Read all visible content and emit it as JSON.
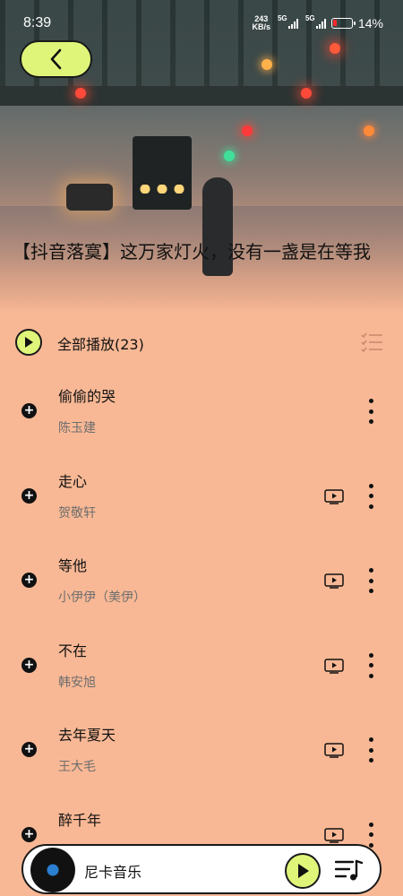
{
  "status_bar": {
    "time": "8:39",
    "net_speed_value": "243",
    "net_speed_unit": "KB/s",
    "sim1": "5G",
    "sim2": "5G",
    "battery_percent": "14%"
  },
  "header": {
    "back_icon": "chevron-left-icon",
    "playlist_title": "【抖音落寞】这万家灯火，没有一盏是在等我"
  },
  "play_all": {
    "label": "全部播放(23)",
    "icons": [
      "play-icon",
      "multi-select-list-icon"
    ]
  },
  "songs": [
    {
      "title": "偷偷的哭",
      "artist": "陈玉建",
      "has_mv": false
    },
    {
      "title": "走心",
      "artist": "贺敬轩",
      "has_mv": true
    },
    {
      "title": "等他",
      "artist": "小伊伊（美伊）",
      "has_mv": true
    },
    {
      "title": "不在",
      "artist": "韩安旭",
      "has_mv": true
    },
    {
      "title": "去年夏天",
      "artist": "王大毛",
      "has_mv": true
    },
    {
      "title": "醉千年",
      "artist": "",
      "has_mv": true
    }
  ],
  "player": {
    "now_playing": "尼卡音乐",
    "icons": [
      "vinyl-disc-icon",
      "play-icon",
      "playlist-queue-icon"
    ]
  },
  "colors": {
    "background": "#F8B895",
    "accent": "#DFF57A",
    "text": "#111111",
    "secondary_text": "#6E6E6E"
  }
}
